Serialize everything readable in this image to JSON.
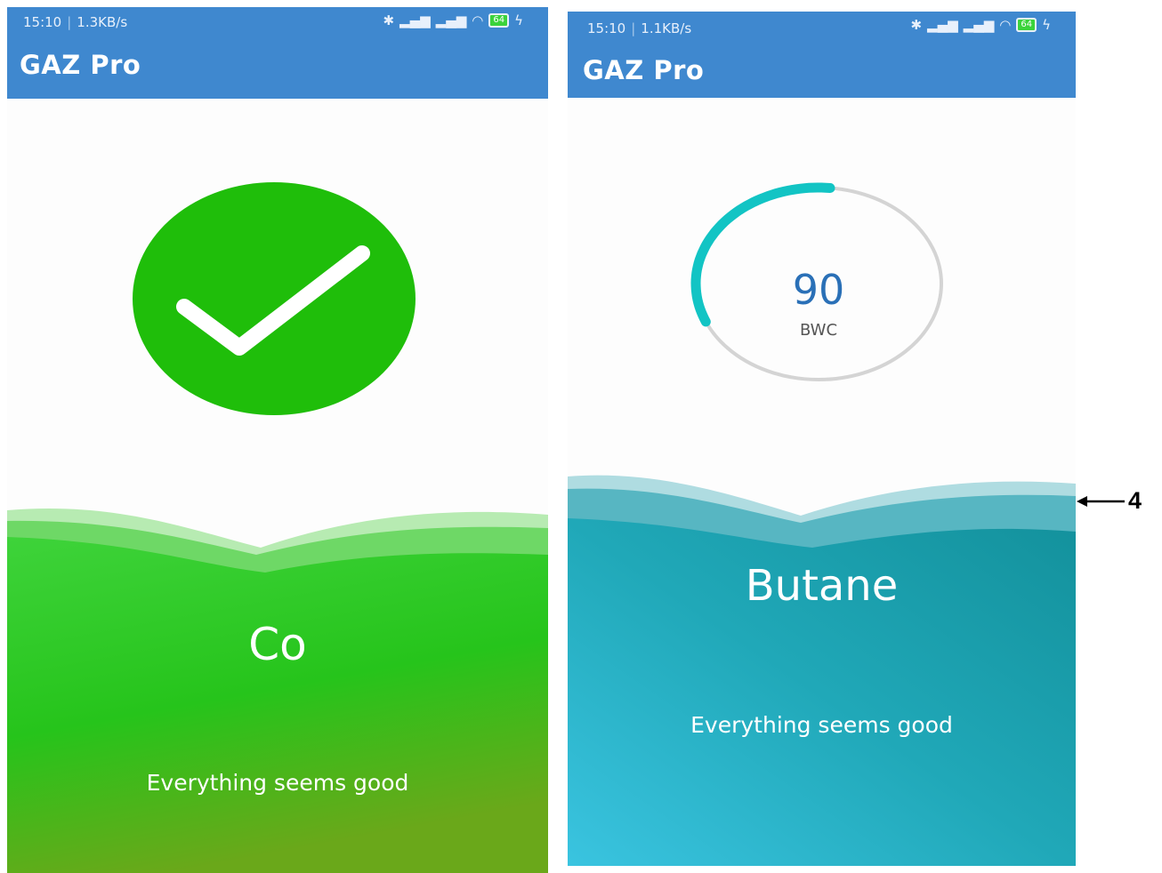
{
  "colors": {
    "appbar": "#3f88cf",
    "ok_green": "#1fbe0a",
    "gauge_teal": "#12c4c4",
    "gauge_track": "#d4d4d4",
    "wave_green_top": "#3ed33a",
    "wave_green_bottom": "#6aa81a",
    "wave_teal_top": "#1e9fb0",
    "wave_teal_bottom": "#35c1de"
  },
  "left_screen": {
    "status_bar": {
      "time": "15:10",
      "speed": "1.3KB/s",
      "battery": "64"
    },
    "app_title": "GAZ Pro",
    "status_icon": "checkmark-icon",
    "gas_name": "Co",
    "message": "Everything seems good"
  },
  "right_screen": {
    "status_bar": {
      "time": "15:10",
      "speed": "1.1KB/s",
      "battery": "64"
    },
    "app_title": "GAZ Pro",
    "gauge": {
      "value": "90",
      "unit": "BWC",
      "fill_fraction": 0.33
    },
    "gas_name": "Butane",
    "message": "Everything seems good"
  },
  "annotation": {
    "label": "4"
  }
}
